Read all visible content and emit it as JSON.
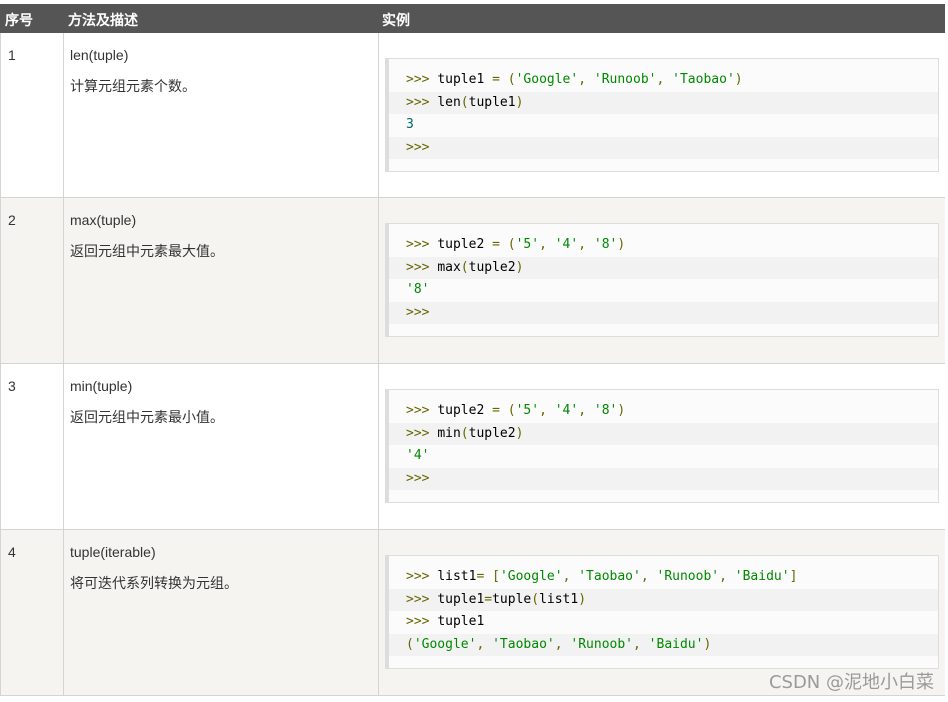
{
  "header": {
    "col_index": "序号",
    "col_method": "方法及描述",
    "col_example": "实例"
  },
  "rows": [
    {
      "index": "1",
      "method": "len(tuple)",
      "description": "计算元组元素个数。",
      "code": [
        ">>> tuple1 = ('Google', 'Runoob', 'Taobao')",
        ">>> len(tuple1)",
        "3",
        ">>>"
      ]
    },
    {
      "index": "2",
      "method": "max(tuple)",
      "description": "返回元组中元素最大值。",
      "code": [
        ">>> tuple2 = ('5', '4', '8')",
        ">>> max(tuple2)",
        "'8'",
        ">>>"
      ]
    },
    {
      "index": "3",
      "method": "min(tuple)",
      "description": "返回元组中元素最小值。",
      "code": [
        ">>> tuple2 = ('5', '4', '8')",
        ">>> min(tuple2)",
        "'4'",
        ">>>"
      ]
    },
    {
      "index": "4",
      "method": "tuple(iterable)",
      "description": "将可迭代系列转换为元组。",
      "code": [
        ">>> list1= ['Google', 'Taobao', 'Runoob', 'Baidu']",
        ">>> tuple1=tuple(list1)",
        ">>> tuple1",
        "('Google', 'Taobao', 'Runoob', 'Baidu')"
      ]
    }
  ],
  "watermark": "CSDN @泥地小白菜"
}
